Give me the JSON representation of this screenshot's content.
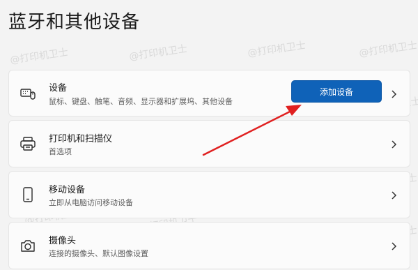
{
  "page": {
    "title": "蓝牙和其他设备"
  },
  "watermark": {
    "text": "@打印机卫士"
  },
  "cards": [
    {
      "title": "设备",
      "subtitle": "鼠标、键盘、触笔、音频、显示器和扩展坞、其他设备",
      "icon": "keyboard-mouse-icon",
      "button_label": "添加设备"
    },
    {
      "title": "打印机和扫描仪",
      "subtitle": "首选项",
      "icon": "printer-icon"
    },
    {
      "title": "移动设备",
      "subtitle": "立即从电脑访问移动设备",
      "icon": "phone-icon"
    },
    {
      "title": "摄像头",
      "subtitle": "连接的摄像头、默认图像设置",
      "icon": "camera-icon"
    }
  ],
  "colors": {
    "accent": "#0f62b8",
    "arrow": "#e02020",
    "background": "#f3f3f3"
  }
}
